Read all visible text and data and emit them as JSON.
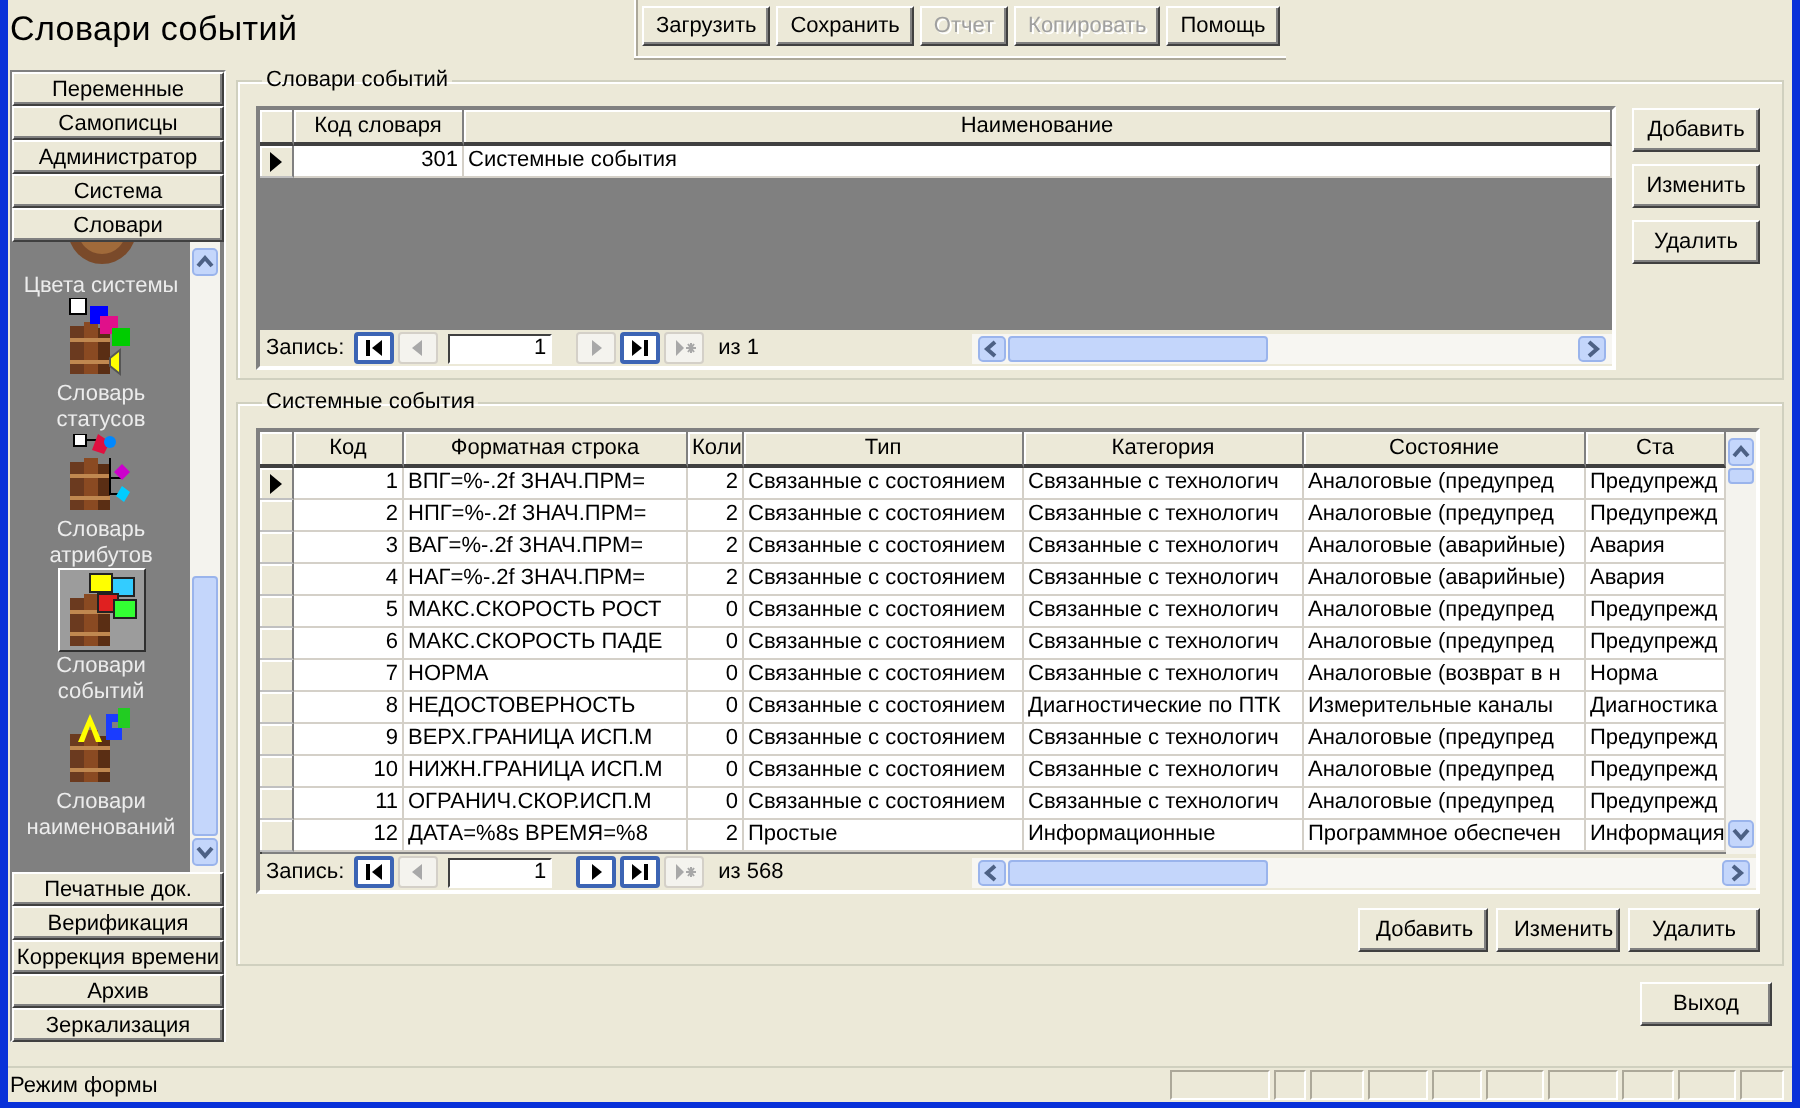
{
  "window": {
    "title": "Словари событий"
  },
  "toolbar": [
    {
      "label": "Загрузить",
      "disabled": false
    },
    {
      "label": "Сохранить",
      "disabled": false
    },
    {
      "label": "Отчет",
      "disabled": true
    },
    {
      "label": "Копировать",
      "disabled": true
    },
    {
      "label": "Помощь",
      "disabled": false
    }
  ],
  "sidebar": {
    "top_buttons": [
      "Переменные",
      "Самописцы",
      "Администратор",
      "Система",
      "Словари"
    ],
    "items": [
      {
        "label": "Цвета системы",
        "selected": false
      },
      {
        "label": "Словарь статусов",
        "selected": false
      },
      {
        "label": "Словарь атрибутов",
        "selected": false
      },
      {
        "label": "Словари событий",
        "selected": true
      },
      {
        "label": "Словари наименований",
        "selected": false
      }
    ],
    "bottom_buttons": [
      "Печатные док.",
      "Верификация",
      "Коррекция времени",
      "Архив",
      "Зеркализация"
    ]
  },
  "dictionaries": {
    "title": "Словари событий",
    "columns": [
      "Код словаря",
      "Наименование"
    ],
    "rows": [
      {
        "current": true,
        "cells": [
          "301",
          "Системные события"
        ]
      }
    ],
    "navigator": {
      "label": "Запись:",
      "record": "1",
      "total": "из 1",
      "at_start": true,
      "at_end": true
    },
    "buttons": [
      "Добавить",
      "Изменить",
      "Удалить"
    ]
  },
  "events": {
    "title": "Системные события",
    "columns": [
      "Код",
      "Форматная строка",
      "Коли",
      "Тип",
      "Категория",
      "Состояние",
      "Ста"
    ],
    "rows": [
      {
        "current": true,
        "cells": [
          "1",
          "ВПГ=%-.2f ЗНАЧ.ПРМ=",
          "2",
          "Связанные с состоянием",
          "Связанные с технологич",
          "Аналоговые (предупред",
          "Предупрежд"
        ]
      },
      {
        "current": false,
        "cells": [
          "2",
          "НПГ=%-.2f ЗНАЧ.ПРМ=",
          "2",
          "Связанные с состоянием",
          "Связанные с технологич",
          "Аналоговые (предупред",
          "Предупрежд"
        ]
      },
      {
        "current": false,
        "cells": [
          "3",
          "ВАГ=%-.2f ЗНАЧ.ПРМ=",
          "2",
          "Связанные с состоянием",
          "Связанные с технологич",
          "Аналоговые (аварийные)",
          "Авария"
        ]
      },
      {
        "current": false,
        "cells": [
          "4",
          "НАГ=%-.2f ЗНАЧ.ПРМ=",
          "2",
          "Связанные с состоянием",
          "Связанные с технологич",
          "Аналоговые (аварийные)",
          "Авария"
        ]
      },
      {
        "current": false,
        "cells": [
          "5",
          "МАКС.СКОРОСТЬ РОСТ",
          "0",
          "Связанные с состоянием",
          "Связанные с технологич",
          "Аналоговые (предупред",
          "Предупрежд"
        ]
      },
      {
        "current": false,
        "cells": [
          "6",
          "МАКС.СКОРОСТЬ ПАДЕ",
          "0",
          "Связанные с состоянием",
          "Связанные с технологич",
          "Аналоговые (предупред",
          "Предупрежд"
        ]
      },
      {
        "current": false,
        "cells": [
          "7",
          "НОРМА",
          "0",
          "Связанные с состоянием",
          "Связанные с технологич",
          "Аналоговые (возврат в н",
          "Норма"
        ]
      },
      {
        "current": false,
        "cells": [
          "8",
          "НЕДОСТОВЕРНОСТЬ",
          "0",
          "Связанные с состоянием",
          "Диагностические по ПТК",
          "Измерительные каналы",
          "Диагностика"
        ]
      },
      {
        "current": false,
        "cells": [
          "9",
          "ВЕРХ.ГРАНИЦА ИСП.М",
          "0",
          "Связанные с состоянием",
          "Связанные с технологич",
          "Аналоговые (предупред",
          "Предупрежд"
        ]
      },
      {
        "current": false,
        "cells": [
          "10",
          "НИЖН.ГРАНИЦА ИСП.М",
          "0",
          "Связанные с состоянием",
          "Связанные с технологич",
          "Аналоговые (предупред",
          "Предупрежд"
        ]
      },
      {
        "current": false,
        "cells": [
          "11",
          "ОГРАНИЧ.СКОР.ИСП.М",
          "0",
          "Связанные с состоянием",
          "Связанные с технологич",
          "Аналоговые (предупред",
          "Предупрежд"
        ]
      },
      {
        "current": false,
        "cells": [
          "12",
          "ДАТА=%8s ВРЕМЯ=%8",
          "2",
          "Простые",
          "Информационные",
          "Программное обеспечен",
          "Информация"
        ]
      }
    ],
    "navigator": {
      "label": "Запись:",
      "record": "1",
      "total": "из 568",
      "at_start": true,
      "at_end": false
    },
    "buttons": [
      "Добавить",
      "Изменить",
      "Удалить"
    ]
  },
  "exit_button": "Выход",
  "status_bar": {
    "text": "Режим формы"
  }
}
